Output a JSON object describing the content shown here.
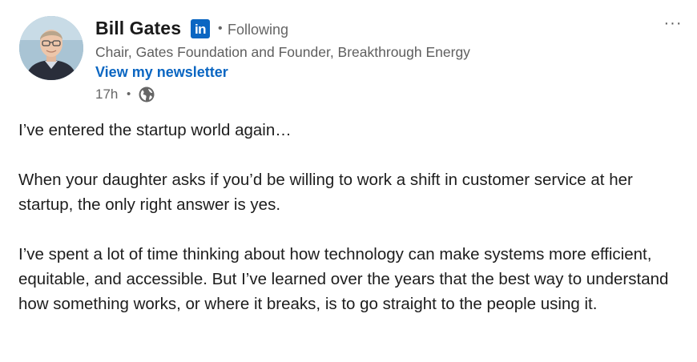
{
  "author": {
    "name": "Bill Gates",
    "badge": "in",
    "separator": "•",
    "follow_status": "Following",
    "headline": "Chair, Gates Foundation and Founder, Breakthrough Energy",
    "newsletter_link": "View my newsletter"
  },
  "meta": {
    "time_ago": "17h",
    "separator": "•",
    "visibility_icon": "globe-icon"
  },
  "menu": {
    "more_label": "···",
    "more_icon": "more-options-icon"
  },
  "post": {
    "paragraphs": [
      "I’ve entered the startup world again…",
      "When your daughter asks if you’d be willing to work a shift in customer service at her startup, the only right answer is yes.",
      "I’ve spent a lot of time thinking about how technology can make systems more efficient, equitable, and accessible. But I’ve learned over the years that the best way to understand how something works, or where it breaks, is to go straight to the people using it."
    ]
  },
  "colors": {
    "link": "#0a66c2",
    "linkedin_badge": "#0a66c2",
    "secondary_text": "#666666",
    "primary_text": "#1d1d1d"
  }
}
